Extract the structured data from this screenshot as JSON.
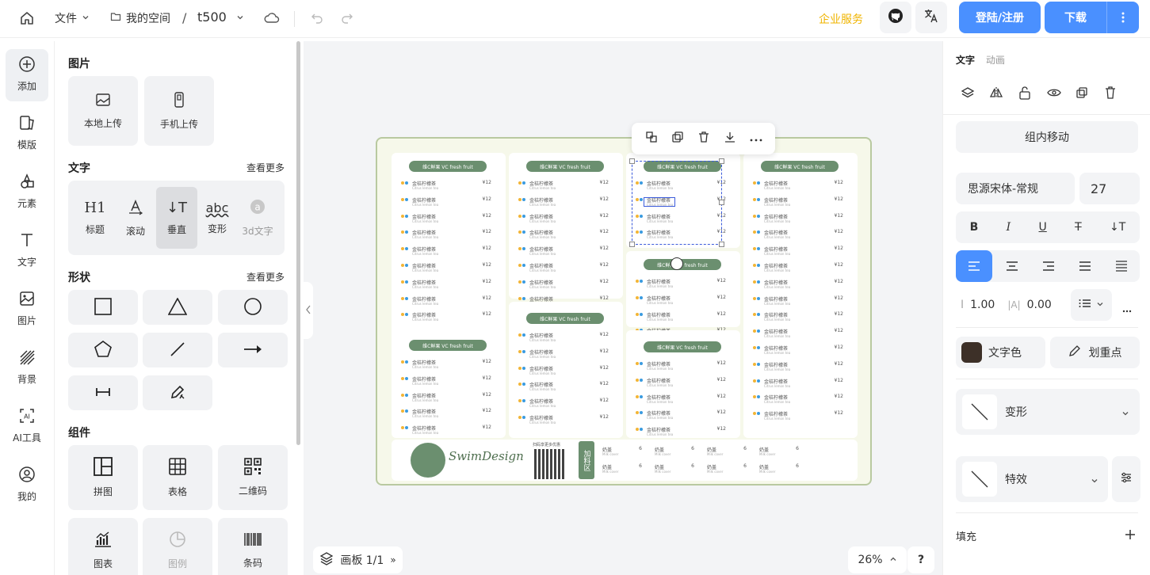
{
  "topbar": {
    "file_label": "文件",
    "space_label": "我的空间",
    "separator": "/",
    "doc_name": "t500",
    "enterprise": "企业服务",
    "login_btn": "登陆/注册",
    "download_btn": "下载"
  },
  "leftnav": {
    "items": [
      {
        "label": "添加",
        "icon": "plus-circle-icon"
      },
      {
        "label": "模版",
        "icon": "template-icon"
      },
      {
        "label": "元素",
        "icon": "elements-icon"
      },
      {
        "label": "文字",
        "icon": "text-icon"
      },
      {
        "label": "图片",
        "icon": "image-icon"
      },
      {
        "label": "背景",
        "icon": "background-icon"
      },
      {
        "label": "AI工具",
        "icon": "ai-icon"
      },
      {
        "label": "我的",
        "icon": "user-icon"
      }
    ]
  },
  "panel": {
    "images": {
      "title": "图片",
      "local_upload": "本地上传",
      "phone_upload": "手机上传"
    },
    "text": {
      "title": "文字",
      "more": "查看更多",
      "items": [
        "标题",
        "滚动",
        "垂直",
        "变形",
        "3d文字"
      ],
      "heading_glyph": "H1",
      "vertical_glyph": "↓T",
      "abc_glyph": "abc"
    },
    "shapes": {
      "title": "形状",
      "more": "查看更多"
    },
    "components": {
      "title": "组件",
      "items": [
        "拼图",
        "表格",
        "二维码",
        "图表",
        "图例",
        "条码"
      ]
    }
  },
  "canvas": {
    "menu_header": "维C鲜果 VC fresh fruit",
    "item_name": "金桔柠檬茶",
    "item_sub": "Citrus lemon tea",
    "item_price": "¥12",
    "brand": "SwimDesign",
    "qr_caption": "扫码享更多优惠",
    "addon_label": "加料区",
    "addon_item": "奶盖",
    "addon_sub": "Milk cover",
    "addon_price": "6",
    "board_label": "画板 1/1",
    "zoom": "26%",
    "help": "?"
  },
  "rpanel": {
    "tabs": [
      "文字",
      "动画"
    ],
    "move_in_group": "组内移动",
    "font_name": "思源宋体-常规",
    "font_size": "27",
    "line_height": "1.00",
    "letter_spacing": "0.00",
    "text_color_label": "文字色",
    "highlight_label": "划重点",
    "transform_label": "变形",
    "effect_label": "特效",
    "fill_label": "填充",
    "text_color": "#3d3028",
    "accent": "#4a90ff"
  }
}
